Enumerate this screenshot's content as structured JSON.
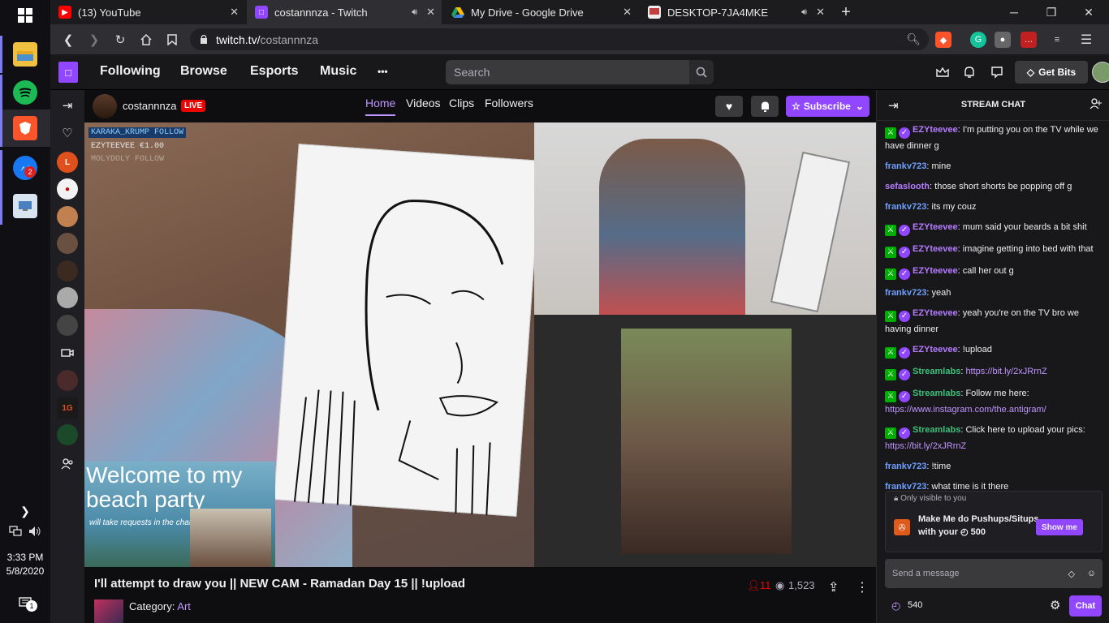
{
  "browser": {
    "tabs": [
      {
        "label": "(13) YouTube"
      },
      {
        "label": "costannnza - Twitch"
      },
      {
        "label": "My Drive - Google Drive"
      },
      {
        "label": "DESKTOP-7JA4MKE"
      }
    ],
    "url_host": "twitch.tv/",
    "url_path": "costannnza"
  },
  "taskbar": {
    "time": "3:33 PM",
    "date": "5/8/2020",
    "messenger_badge": "2",
    "notification_badge": "1"
  },
  "twitch_nav": {
    "links": [
      "Following",
      "Browse",
      "Esports",
      "Music"
    ],
    "more": "•••",
    "search_placeholder": "Search",
    "get_bits": "Get Bits"
  },
  "channel": {
    "name": "costannnza",
    "live": "LIVE",
    "tabs": [
      "Home",
      "Videos",
      "Clips",
      "Followers"
    ],
    "subscribe": "Subscribe"
  },
  "video": {
    "overlay_lines": [
      "KARAKA_KRUMP FOLLOW",
      "EZYTEEVEE €1.00",
      "MOLYDOLY FOLLOW"
    ],
    "welcome_title": "Welcome to my beach party",
    "welcome_sub": "will take requests in the chat / Whatsapp"
  },
  "stream": {
    "title": "I'll attempt to draw you || NEW CAM - Ramadan Day 15 || !upload",
    "category_label": "Category:",
    "category": "Art",
    "hype": "11",
    "viewers": "1,523"
  },
  "chat": {
    "header": "STREAM CHAT",
    "messages": [
      {
        "badges": true,
        "user": "EZYteevee",
        "color": "#b57cff",
        "text": "I'm putting you on the TV while we have dinner g"
      },
      {
        "badges": false,
        "user": "frankv723",
        "color": "#6f9fff",
        "text": "mine"
      },
      {
        "badges": false,
        "user": "sefaslooth",
        "color": "#b57cff",
        "text": "those short shorts be popping off g"
      },
      {
        "badges": false,
        "user": "frankv723",
        "color": "#6f9fff",
        "text": "its my couz"
      },
      {
        "badges": true,
        "user": "EZYteevee",
        "color": "#b57cff",
        "text": "mum said your beards a bit shit"
      },
      {
        "badges": true,
        "user": "EZYteevee",
        "color": "#b57cff",
        "text": "imagine getting into bed with that"
      },
      {
        "badges": true,
        "user": "EZYteevee",
        "color": "#b57cff",
        "text": "call her out g"
      },
      {
        "badges": false,
        "user": "frankv723",
        "color": "#6f9fff",
        "text": "yeah"
      },
      {
        "badges": true,
        "user": "EZYteevee",
        "color": "#b57cff",
        "text": "yeah you're on the TV bro we having dinner"
      },
      {
        "badges": true,
        "user": "EZYteevee",
        "color": "#b57cff",
        "text": "!upload"
      },
      {
        "badges": true,
        "user": "Streamlabs",
        "color": "#3cc07a",
        "text": "",
        "link": "https://bit.ly/2xJRrnZ"
      },
      {
        "badges": true,
        "user": "Streamlabs",
        "color": "#3cc07a",
        "text": "Follow me here:",
        "link": "https://www.instagram.com/the.antigram/"
      },
      {
        "badges": true,
        "user": "Streamlabs",
        "color": "#3cc07a",
        "text": "Click here to upload your pics:",
        "link": "https://bit.ly/2xJRrnZ"
      },
      {
        "badges": false,
        "user": "frankv723",
        "color": "#6f9fff",
        "text": "!time"
      },
      {
        "badges": false,
        "user": "frankv723",
        "color": "#6f9fff",
        "text": "what time is it there"
      }
    ],
    "only_visible": "Only visible to you",
    "reward_text": "Make Me do Pushups/Situps with your",
    "reward_cost": "500",
    "show_me": "Show me",
    "input_placeholder": "Send a message",
    "points": "540",
    "chat_button": "Chat"
  }
}
